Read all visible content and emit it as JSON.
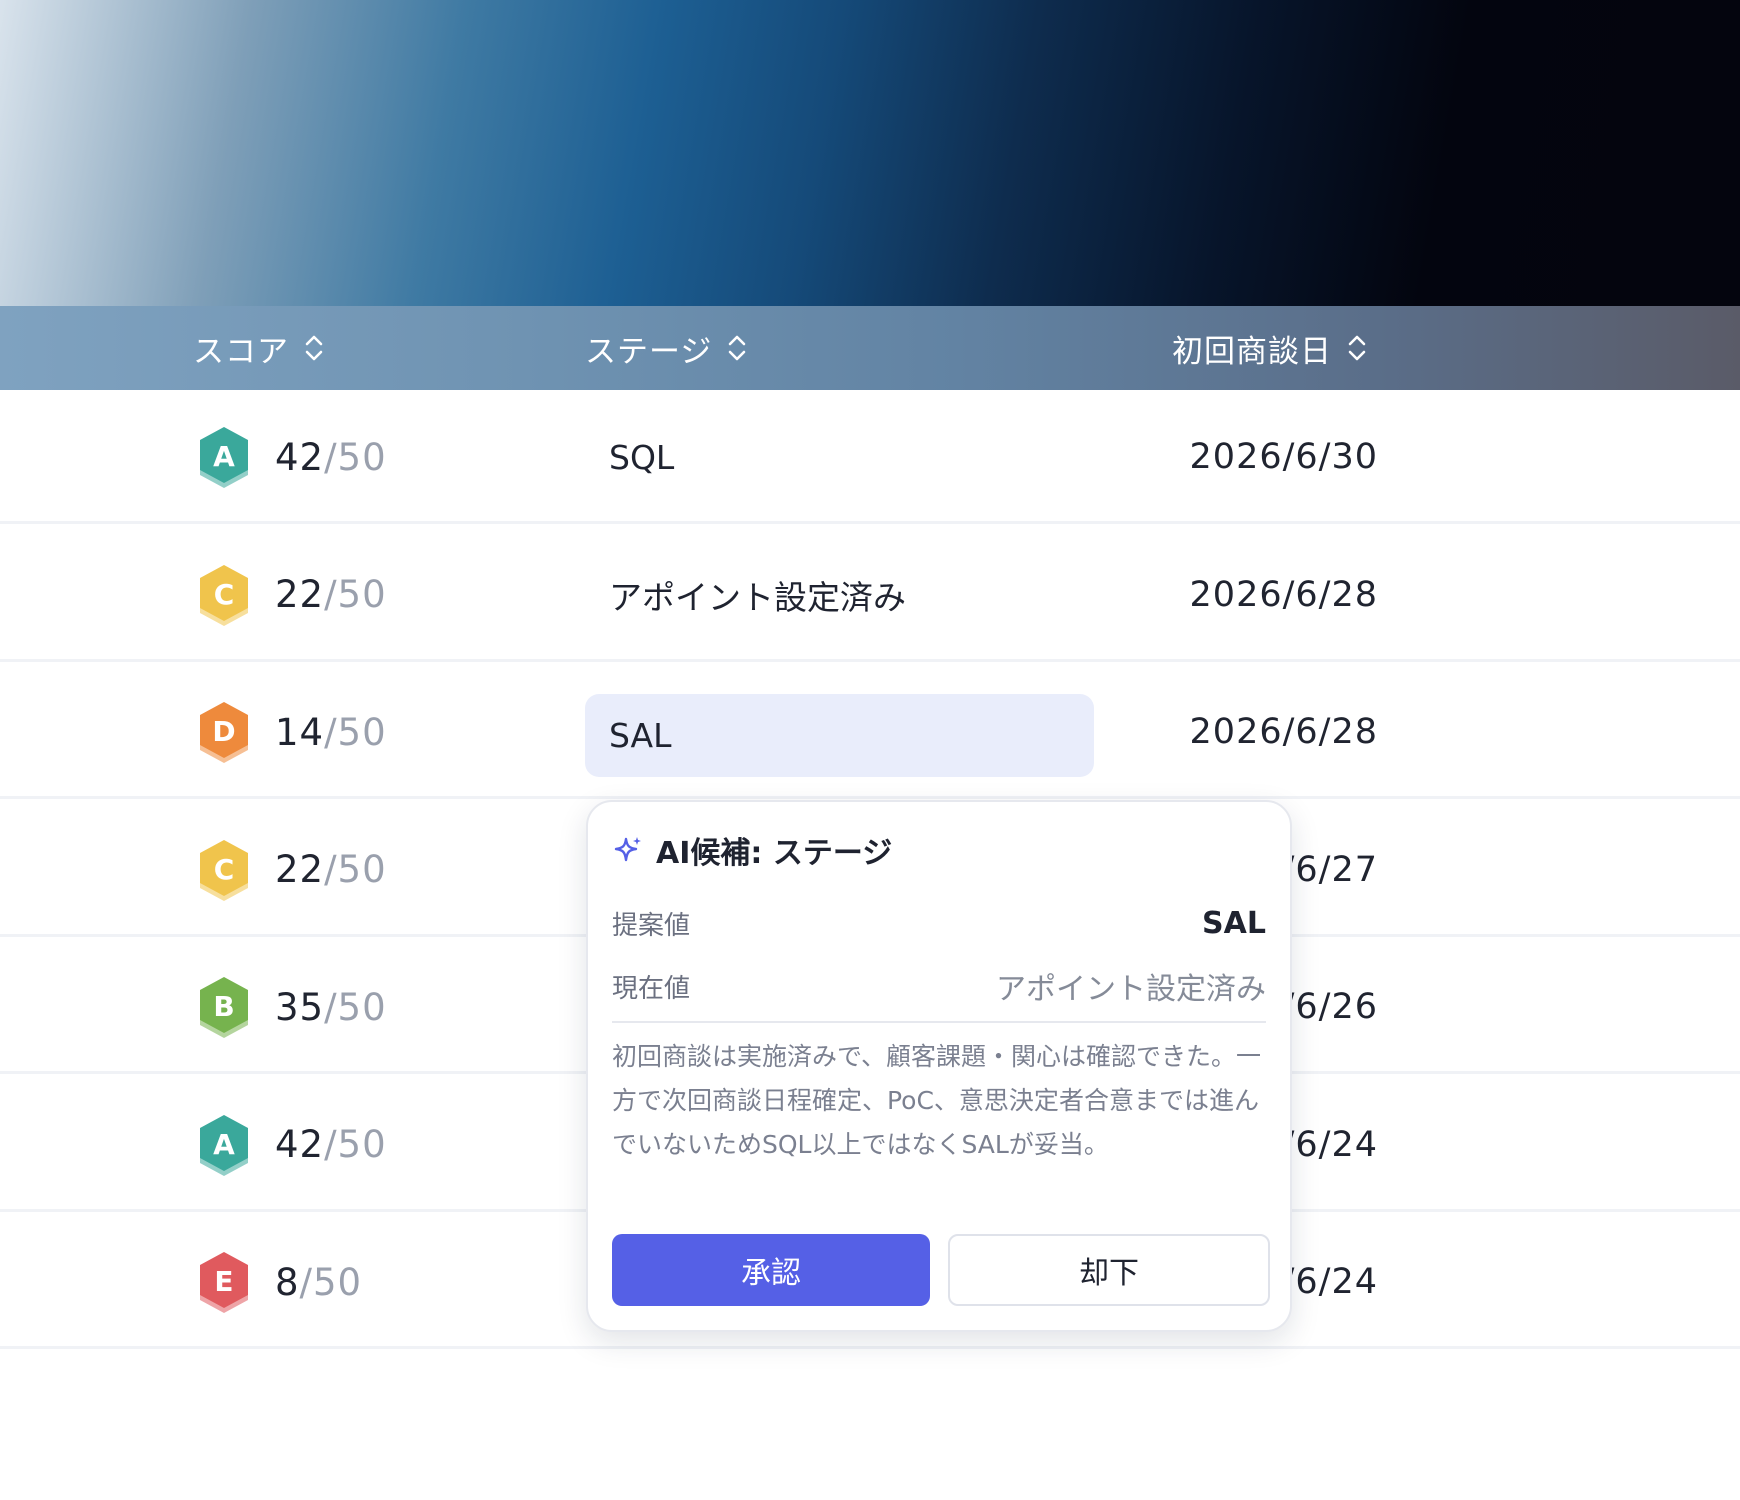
{
  "header": {
    "columns": [
      {
        "label": "スコア"
      },
      {
        "label": "ステージ"
      },
      {
        "label": "初回商談日"
      }
    ]
  },
  "rows": [
    {
      "grade": "A",
      "grade_color": "#3aa89b",
      "score": "42",
      "max": "/50",
      "stage": "SQL",
      "date": "2026/6/30"
    },
    {
      "grade": "C",
      "grade_color": "#f0c44c",
      "score": "22",
      "max": "/50",
      "stage": "アポイント設定済み",
      "date": "2026/6/28"
    },
    {
      "grade": "D",
      "grade_color": "#ee8a3c",
      "score": "14",
      "max": "/50",
      "stage": "SAL",
      "date": "2026/6/28"
    },
    {
      "grade": "C",
      "grade_color": "#f0c44c",
      "score": "22",
      "max": "/50",
      "stage": "",
      "date": "/6/27"
    },
    {
      "grade": "B",
      "grade_color": "#76b34e",
      "score": "35",
      "max": "/50",
      "stage": "",
      "date": "/6/26"
    },
    {
      "grade": "A",
      "grade_color": "#3aa89b",
      "score": "42",
      "max": "/50",
      "stage": "",
      "date": "/6/24"
    },
    {
      "grade": "E",
      "grade_color": "#e05a5e",
      "score": "8",
      "max": "/50",
      "stage": "",
      "date": "/6/24"
    }
  ],
  "popover": {
    "title": "AI候補: ステージ",
    "proposed_label": "提案値",
    "proposed_value": "SAL",
    "current_label": "現在値",
    "current_value": "アポイント設定済み",
    "reason": "初回商談は実施済みで、顧客課題・関心は確認できた。一方で次回商談日程確定、PoC、意思決定者合意までは進んでいないためSQL以上ではなくSALが妥当。",
    "approve_label": "承認",
    "reject_label": "却下"
  },
  "colors": {
    "accent": "#5560e6",
    "highlight": "#e9edfb"
  }
}
